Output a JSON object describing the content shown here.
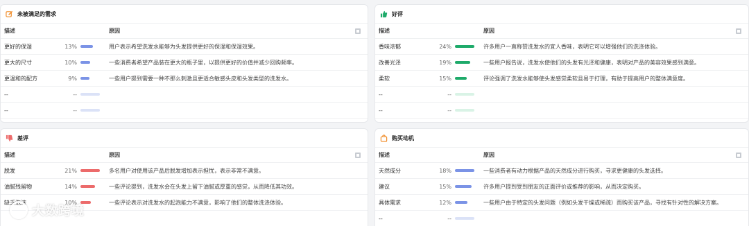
{
  "unmet": {
    "title": "未被满足的需求",
    "icon": "edit-icon",
    "accent": "#f08a24",
    "headers": {
      "desc": "描述",
      "reason": "原因"
    },
    "rows": [
      {
        "desc": "更好的保湿",
        "pct": "13%",
        "value": 0.65,
        "reason": "用户表示希望洗发水能够为头发提供更好的保湿和保湿效果。"
      },
      {
        "desc": "更大的尺寸",
        "pct": "10%",
        "value": 0.5,
        "reason": "一些消费者希望产品装在更大的瓶子里，以提供更好的价值并减少回购频率。"
      },
      {
        "desc": "更温和的配方",
        "pct": "9%",
        "value": 0.45,
        "reason": "一些用户提到需要一种不那么刺激且更适合敏感头皮和头发类型的洗发水。"
      },
      {
        "desc": "--",
        "pct": "--",
        "value": 0,
        "reason": ""
      },
      {
        "desc": "--",
        "pct": "--",
        "value": 0,
        "reason": ""
      }
    ]
  },
  "good": {
    "title": "好评",
    "icon": "thumbs-up-icon",
    "accent": "#1eaa6a",
    "headers": {
      "desc": "描述",
      "reason": "原因"
    },
    "rows": [
      {
        "desc": "香味浓郁",
        "pct": "24%",
        "value": 1.0,
        "reason": "许多用户一直称赞洗发水的宜人香味，表明它可以增强他们的洗涤体验。"
      },
      {
        "desc": "改善光泽",
        "pct": "19%",
        "value": 0.8,
        "reason": "一些用户报告说，洗发水使他们的头发有光泽和健康，表明对产品的美容效果感到满意。"
      },
      {
        "desc": "柔软",
        "pct": "15%",
        "value": 0.62,
        "reason": "评论强调了洗发水能够使头发感觉柔软且易于打理，有助于提高用户的整体满意度。"
      },
      {
        "desc": "--",
        "pct": "--",
        "value": 0,
        "reason": ""
      },
      {
        "desc": "--",
        "pct": "--",
        "value": 0,
        "reason": ""
      }
    ]
  },
  "bad": {
    "title": "差评",
    "icon": "thumbs-down-icon",
    "accent": "#ec6b6b",
    "headers": {
      "desc": "描述",
      "reason": "原因"
    },
    "rows": [
      {
        "desc": "脱发",
        "pct": "21%",
        "value": 1.0,
        "reason": "多名用户对使用该产品后脱发增加表示担忧，表示非常不满意。"
      },
      {
        "desc": "油腻残留物",
        "pct": "14%",
        "value": 0.75,
        "reason": "一些评论提到，洗发水会在头发上留下油腻或厚重的感觉，从而降低其功效。"
      },
      {
        "desc": "缺乏泡沫",
        "pct": "10%",
        "value": 0.55,
        "reason": "一些评论表示对洗发水的起泡能力不满意，影响了他们的整体洗涤体验。"
      }
    ]
  },
  "buy": {
    "title": "购买动机",
    "icon": "shopping-bag-icon",
    "accent": "#f08a24",
    "headers": {
      "desc": "描述",
      "reason": "原因"
    },
    "rows": [
      {
        "desc": "天然成分",
        "pct": "18%",
        "value": 1.0,
        "reason": "一些消费者有动力根据产品的天然成分进行购买，寻求更健康的头发选择。"
      },
      {
        "desc": "建议",
        "pct": "15%",
        "value": 0.85,
        "reason": "许多用户提到受到朋友的正面评价或推荐的影响，从而决定购买。"
      },
      {
        "desc": "具体需求",
        "pct": "12%",
        "value": 0.65,
        "reason": "一些用户由于特定的头发问题（例如头发干燥或稀疏）而购买该产品，寻找有针对性的解决方案。"
      },
      {
        "desc": "--",
        "pct": "--",
        "value": 0,
        "reason": ""
      }
    ]
  },
  "watermark": {
    "text": "大数跨境"
  }
}
